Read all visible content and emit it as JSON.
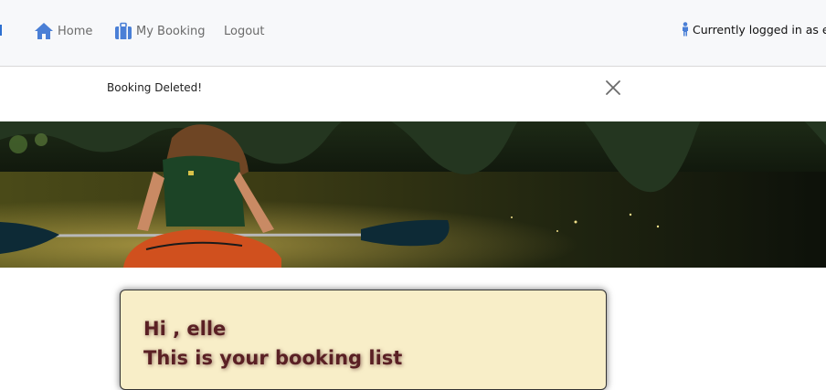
{
  "nav": {
    "home_label": "Home",
    "booking_label": "My Booking",
    "logout_label": "Logout",
    "user_status": "Currently logged in as elle"
  },
  "alert": {
    "message": "Booking Deleted!"
  },
  "card": {
    "greeting": "Hi , elle",
    "subtitle": "This is your booking list"
  },
  "icons": {
    "home": "home-icon",
    "booking": "briefcase-icon",
    "user": "person-icon",
    "close": "close-icon"
  },
  "colors": {
    "nav_icon": "#4a7fd6",
    "card_background": "#f8eec8",
    "card_text": "#5a2024",
    "navbar_background": "#f7f8fa"
  }
}
